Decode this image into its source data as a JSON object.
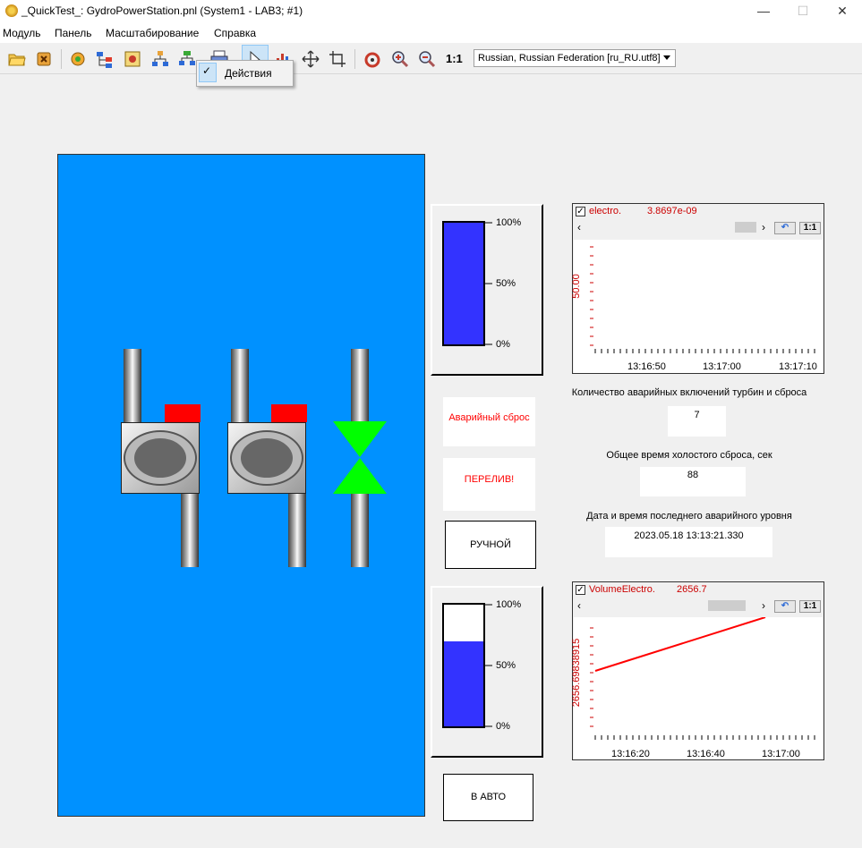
{
  "window": {
    "title": "_QuickTest_: GydroPowerStation.pnl (System1 - LAB3; #1)",
    "controls": {
      "minimize": "—",
      "maximize": "☐",
      "close": "✕"
    }
  },
  "menu": [
    "Модуль",
    "Панель",
    "Масштабирование",
    "Справка"
  ],
  "toolbar": {
    "icons": [
      "open-folder-icon",
      "close-module-icon",
      "settings-icon",
      "tree-icon",
      "image-icon",
      "hierarchy-icon",
      "network-icon",
      "print-icon",
      "pointer-icon",
      "chart-icon",
      "move-icon",
      "crop-icon",
      "refresh-icon",
      "zoom-in-icon",
      "zoom-out-icon"
    ],
    "zoom_reset_label": "1:1",
    "language": "Russian, Russian Federation [ru_RU.utf8]"
  },
  "popup": {
    "check": "✓",
    "item": "Действия"
  },
  "gauges": {
    "tick_100": "100%",
    "tick_50": "50%",
    "tick_0": "0%",
    "upper_level_fraction": 1.0,
    "lower_level_fraction": 0.7,
    "fill_color": "#3333ff"
  },
  "status": {
    "emergency_reset": "Аварийный сброс",
    "overflow": "ПЕРЕЛИВ!",
    "manual_button": "РУЧНОЙ",
    "auto_button": "В АВТО"
  },
  "info": {
    "count_label": "Количество аварийных включений турбин и сброса",
    "count_value": "7",
    "idle_label": "Общее время холостого сброса, сек",
    "idle_value": "88",
    "last_alarm_label": "Дата и время последнего аварийного уровня",
    "last_alarm_value": "2023.05.18 13:13:21.330"
  },
  "colors": {
    "process_bg": "#0091ff",
    "valve": "#00ff00",
    "alarm_flag": "#ff0000",
    "trend_line": "#ff0000"
  },
  "trends": [
    {
      "checkbox": "✓",
      "name": "electro.",
      "value": "3.8697e-09",
      "y_label": "50.00",
      "reset_label": "1:1",
      "time_ticks": [
        "13:16:50",
        "13:17:00",
        "13:17:10"
      ]
    },
    {
      "checkbox": "✓",
      "name": "VolumeElectro.",
      "value": "2656.7",
      "y_label": "2656.69838915",
      "reset_label": "1:1",
      "time_ticks": [
        "13:16:20",
        "13:16:40",
        "13:17:00"
      ]
    }
  ]
}
